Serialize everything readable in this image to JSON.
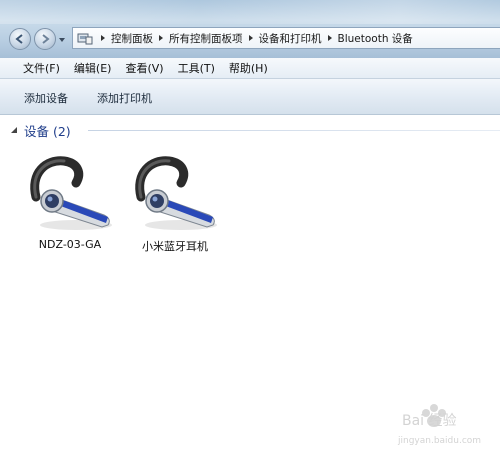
{
  "address": {
    "breadcrumbs": [
      "控制面板",
      "所有控制面板项",
      "设备和打印机",
      "Bluetooth 设备"
    ]
  },
  "menu": {
    "items": [
      "文件(F)",
      "编辑(E)",
      "查看(V)",
      "工具(T)",
      "帮助(H)"
    ]
  },
  "commands": {
    "add_device": "添加设备",
    "add_printer": "添加打印机"
  },
  "group": {
    "title": "设备 (2)"
  },
  "devices": [
    {
      "name": "NDZ-03-GA",
      "icon": "bluetooth-headset-icon"
    },
    {
      "name": "小米蓝牙耳机",
      "icon": "bluetooth-headset-icon"
    }
  ],
  "watermark": {
    "text": "Bai 经验",
    "url": "jingyan.baidu.com"
  },
  "colors": {
    "group_title": "#1f3d8a",
    "headset_accent": "#2a49b8"
  }
}
